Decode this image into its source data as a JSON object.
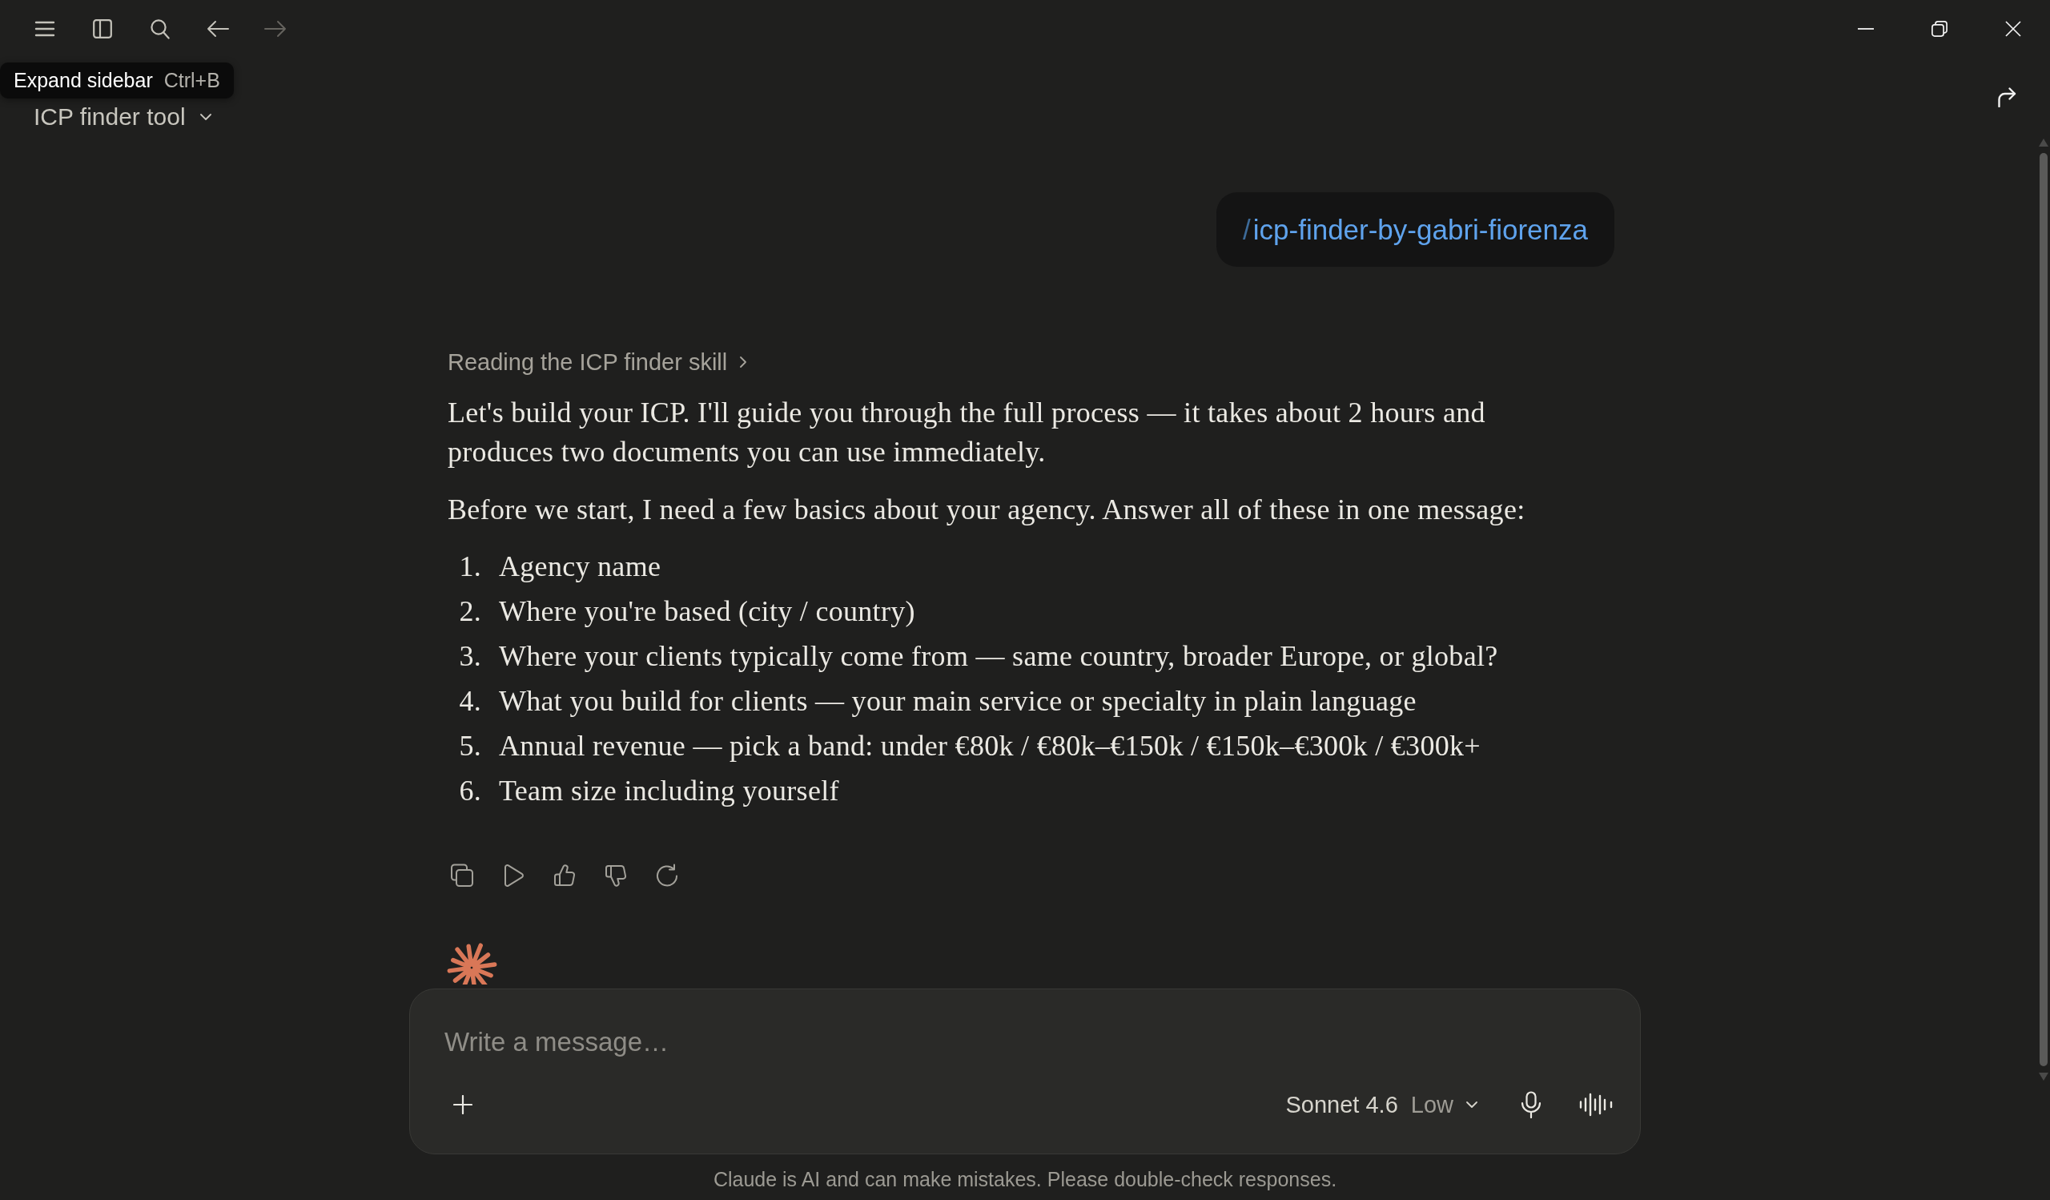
{
  "toolbar": {
    "back": {
      "disabled": false
    },
    "forward": {
      "disabled": true
    }
  },
  "tooltip": {
    "label": "Expand sidebar",
    "shortcut": "Ctrl+B"
  },
  "conversation": {
    "title": "ICP finder tool"
  },
  "messages": [
    {
      "kind": "user",
      "prefix": "/",
      "text": "icp-finder-by-gabri-fiorenza"
    },
    {
      "kind": "assistant",
      "activity": "Reading the ICP finder skill",
      "paragraphs": [
        "Let's build your ICP. I'll guide you through the full process — it takes about 2 hours and produces two documents you can use immediately.",
        "Before we start, I need a few basics about your agency. Answer all of these in one message:"
      ],
      "list": [
        {
          "number": "1.",
          "text": "Agency name"
        },
        {
          "number": "2.",
          "text": "Where you're based (city / country)"
        },
        {
          "number": "3.",
          "text": "Where your clients typically come from — same country, broader Europe, or global?"
        },
        {
          "number": "4.",
          "text": "What you build for clients — your main service or specialty in plain language"
        },
        {
          "number": "5.",
          "text": "Annual revenue — pick a band: under €80k / €80k–€150k / €150k–€300k / €300k+"
        },
        {
          "number": "6.",
          "text": "Team size including yourself"
        }
      ]
    }
  ],
  "composer": {
    "placeholder": "Write a message…",
    "model": "Sonnet 4.6",
    "effort": "Low"
  },
  "disclaimer": "Claude is AI and can make mistakes. Please double-check responses."
}
